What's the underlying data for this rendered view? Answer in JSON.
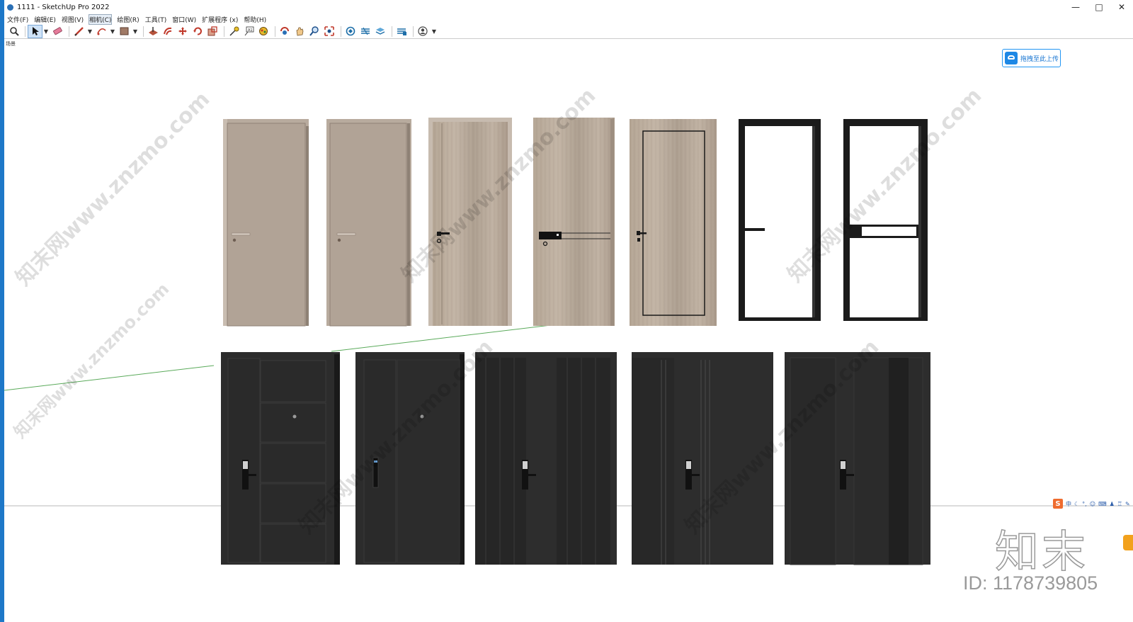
{
  "window": {
    "title": "1111 - SketchUp Pro 2022",
    "controls": [
      "—",
      "□",
      "✕"
    ]
  },
  "menu": [
    {
      "label": "文件(F)"
    },
    {
      "label": "编辑(E)"
    },
    {
      "label": "视图(V)"
    },
    {
      "label": "相机(C)"
    },
    {
      "label": "绘图(R)"
    },
    {
      "label": "工具(T)"
    },
    {
      "label": "窗口(W)"
    },
    {
      "label": "扩展程序 (x)"
    },
    {
      "label": "帮助(H)"
    }
  ],
  "scene_tab": "场景",
  "upload_button": "拖拽至此上传",
  "watermark_text": "知末网www.znzmo.com",
  "brand": {
    "logo": "知末",
    "id_text": "ID: 1178739805"
  },
  "ime_bar": {
    "logo": "S",
    "mode": "中"
  },
  "colors": {
    "title_accent": "#1e78c8",
    "upload_blue": "#1e88e5",
    "door_taupe": "#b5a99d",
    "door_wood": "#b9ab9d",
    "door_black": "#2b2b2b",
    "axis_green": "#5aaa5a"
  }
}
